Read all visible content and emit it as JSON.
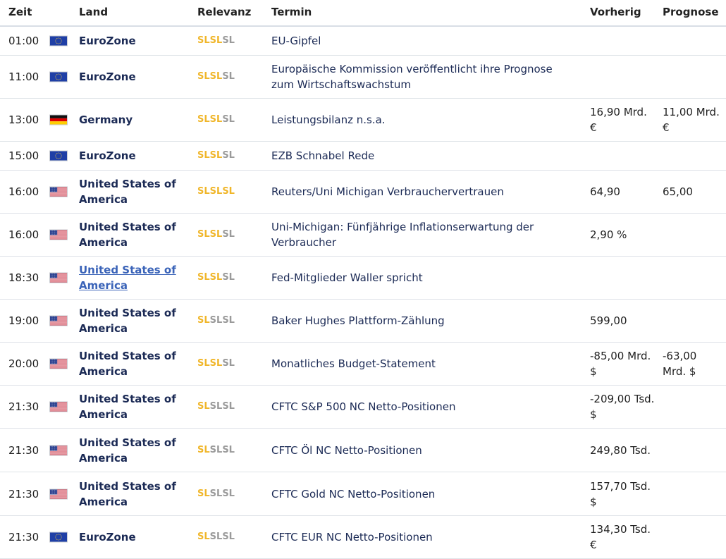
{
  "headers": {
    "zeit": "Zeit",
    "land": "Land",
    "relevanz": "Relevanz",
    "termin": "Termin",
    "vorherig": "Vorherig",
    "prognose": "Prognose"
  },
  "relevance_label": "SL",
  "colors": {
    "relevance_on": "#f0b62a",
    "relevance_off": "#9a9a9a",
    "country_text": "#1b2a55",
    "link": "#3a63b8"
  },
  "rows": [
    {
      "time": "01:00",
      "flag": "eu-flag-icon",
      "country": "EuroZone",
      "relevance": 2,
      "event": "EU-Gipfel",
      "previous": "",
      "forecast": ""
    },
    {
      "time": "11:00",
      "flag": "eu-flag-icon",
      "country": "EuroZone",
      "relevance": 2,
      "event": "Europäische Kommission veröffentlicht ihre Prognose zum Wirtschaftswachstum",
      "previous": "",
      "forecast": ""
    },
    {
      "time": "13:00",
      "flag": "de-flag-icon",
      "country": "Germany",
      "relevance": 2,
      "event": "Leistungsbilanz n.s.a.",
      "previous": "16,90 Mrd. €",
      "forecast": "11,00 Mrd. €"
    },
    {
      "time": "15:00",
      "flag": "eu-flag-icon",
      "country": "EuroZone",
      "relevance": 2,
      "event": "EZB Schnabel Rede",
      "previous": "",
      "forecast": ""
    },
    {
      "time": "16:00",
      "flag": "us-flag-icon",
      "country": "United States of America",
      "relevance": 3,
      "event": "Reuters/Uni Michigan Verbrauchervertrauen",
      "previous": "64,90",
      "forecast": "65,00"
    },
    {
      "time": "16:00",
      "flag": "us-flag-icon",
      "country": "United States of America",
      "relevance": 2,
      "event": "Uni-Michigan: Fünfjährige Inflationserwartung der Verbraucher",
      "previous": "2,90 %",
      "forecast": ""
    },
    {
      "time": "18:30",
      "flag": "us-flag-icon",
      "country": "United States of America",
      "relevance": 2,
      "event": "Fed-Mitglieder Waller spricht",
      "previous": "",
      "forecast": "",
      "link": true
    },
    {
      "time": "19:00",
      "flag": "us-flag-icon",
      "country": "United States of America",
      "relevance": 1,
      "event": "Baker Hughes Plattform-Zählung",
      "previous": "599,00",
      "forecast": ""
    },
    {
      "time": "20:00",
      "flag": "us-flag-icon",
      "country": "United States of America",
      "relevance": 2,
      "event": "Monatliches Budget-Statement",
      "previous": "-85,00 Mrd. $",
      "forecast": "-63,00 Mrd. $"
    },
    {
      "time": "21:30",
      "flag": "us-flag-icon",
      "country": "United States of America",
      "relevance": 1,
      "event": "CFTC S&P 500 NC Netto-Positionen",
      "previous": "-209,00 Tsd. $",
      "forecast": ""
    },
    {
      "time": "21:30",
      "flag": "us-flag-icon",
      "country": "United States of America",
      "relevance": 1,
      "event": "CFTC Öl NC Netto-Positionen",
      "previous": "249,80 Tsd.",
      "forecast": ""
    },
    {
      "time": "21:30",
      "flag": "us-flag-icon",
      "country": "United States of America",
      "relevance": 1,
      "event": "CFTC Gold NC Netto-Positionen",
      "previous": "157,70 Tsd. $",
      "forecast": ""
    },
    {
      "time": "21:30",
      "flag": "eu-flag-icon",
      "country": "EuroZone",
      "relevance": 1,
      "event": "CFTC EUR NC Netto-Positionen",
      "previous": "134,30 Tsd. €",
      "forecast": ""
    }
  ]
}
